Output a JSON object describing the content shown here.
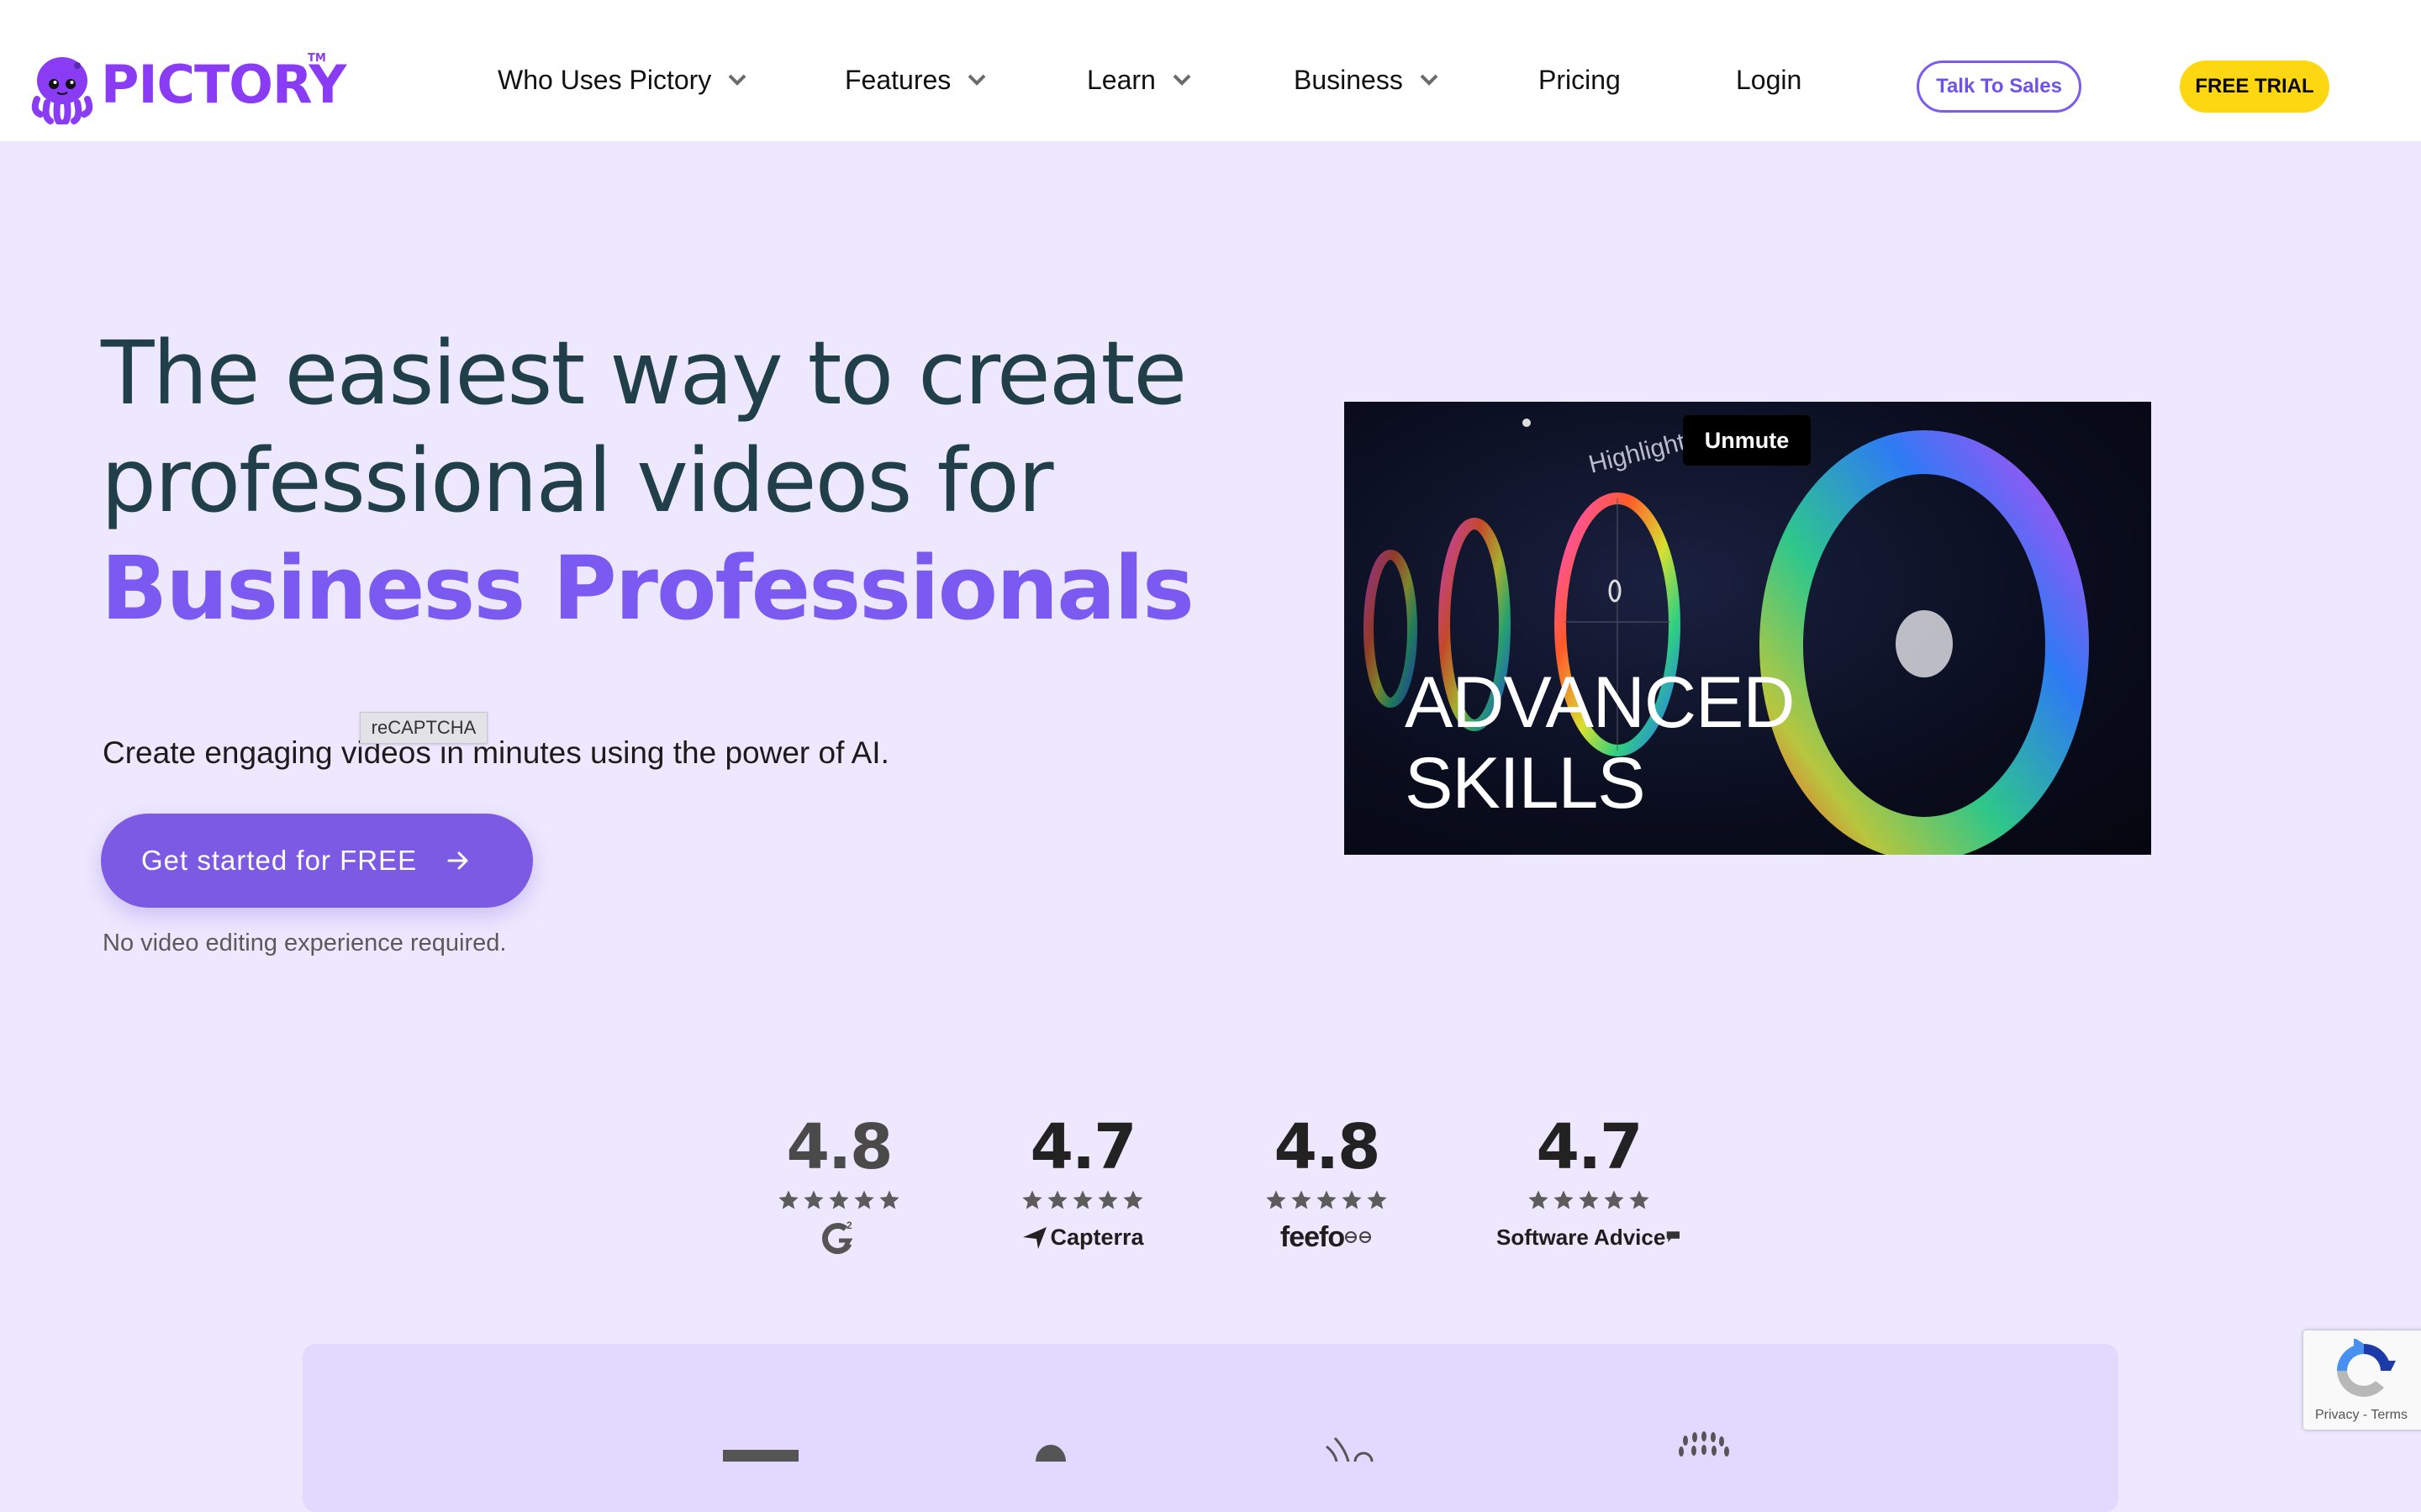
{
  "header": {
    "brand": "PICTORY",
    "trademark": "TM",
    "nav": [
      {
        "label": "Who Uses Pictory",
        "dropdown": true
      },
      {
        "label": "Features",
        "dropdown": true
      },
      {
        "label": "Learn",
        "dropdown": true
      },
      {
        "label": "Business",
        "dropdown": true
      },
      {
        "label": "Pricing",
        "dropdown": false
      },
      {
        "label": "Login",
        "dropdown": false
      }
    ],
    "talk_to_sales": "Talk To Sales",
    "free_trial": "FREE TRIAL"
  },
  "hero": {
    "title_line1": "The easiest way to create",
    "title_line2": "professional videos for",
    "title_accent": "Business Professionals",
    "subtitle": "Create engaging videos in minutes using the power of AI.",
    "recaptcha_tooltip": "reCAPTCHA",
    "cta_label": "Get started for FREE",
    "cta_note": "No video editing experience required."
  },
  "video": {
    "unmute_label": "Unmute",
    "caption_line1": "ADVANCED",
    "caption_line2": "SKILLS",
    "overlay_text": "Highlight"
  },
  "ratings": [
    {
      "score": "4.8",
      "stars": 5,
      "source": "G2"
    },
    {
      "score": "4.7",
      "stars": 5,
      "source": "Capterra"
    },
    {
      "score": "4.8",
      "stars": 5,
      "source": "feefo"
    },
    {
      "score": "4.7",
      "stars": 5,
      "source": "Software Advice"
    }
  ],
  "recaptcha_badge": {
    "links": "Privacy - Terms"
  },
  "colors": {
    "brand_purple": "#8a3cf5",
    "accent_purple": "#7a5af0",
    "cta_purple": "#7c5ae3",
    "trial_yellow": "#fdd712",
    "heading_dark": "#203f48",
    "page_bg": "#ede8fe",
    "panel_bg": "#e2d9fe"
  }
}
